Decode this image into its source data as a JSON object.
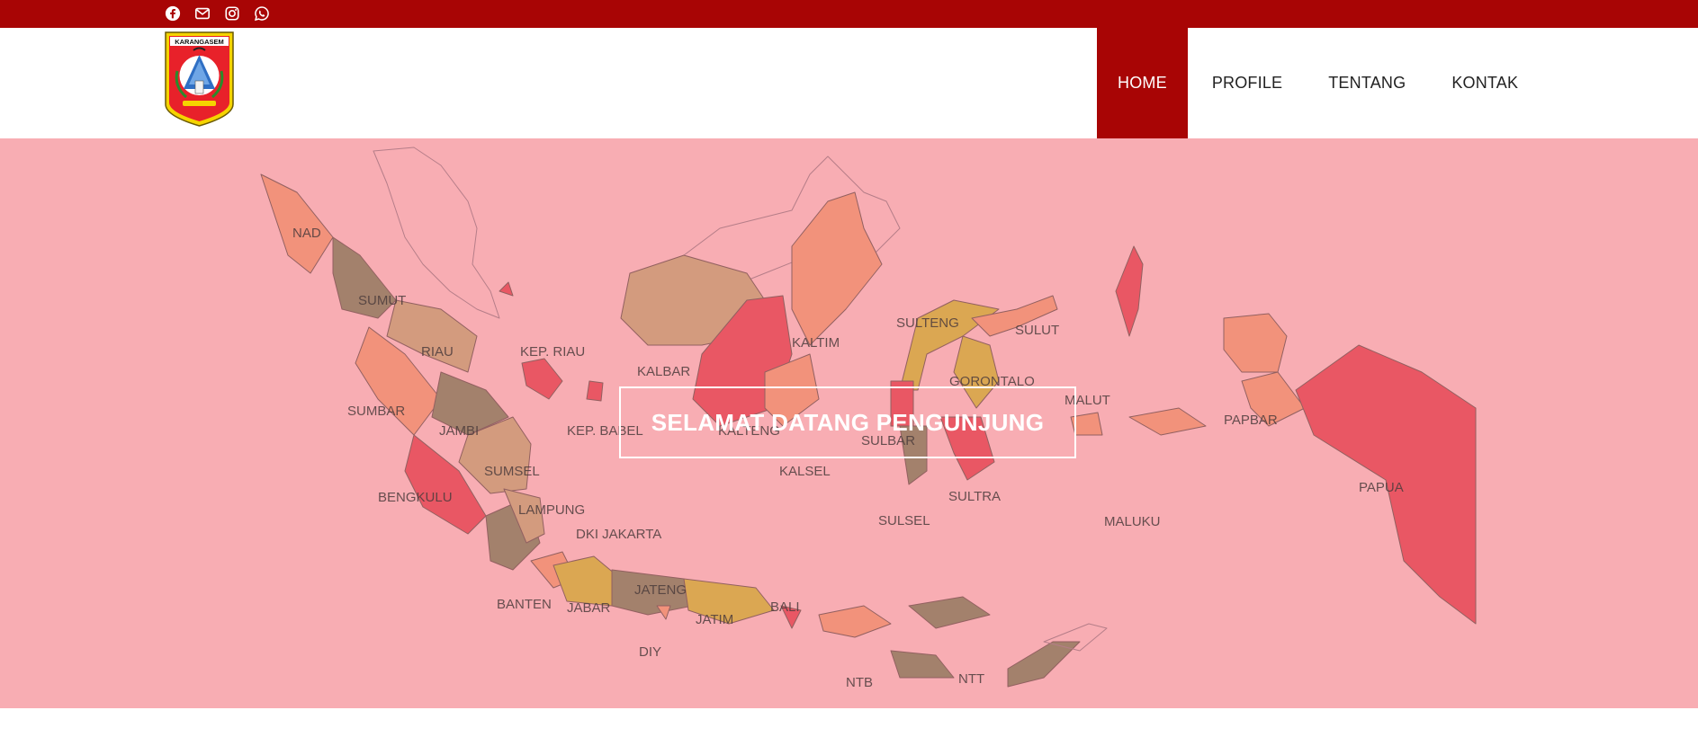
{
  "colors": {
    "brand_red": "#a80505",
    "hero_pink": "#f8adb3"
  },
  "topbar": {
    "social_icons": [
      "facebook-icon",
      "envelope-icon",
      "instagram-icon",
      "whatsapp-icon"
    ]
  },
  "header": {
    "logo_text": "KARANGASEM"
  },
  "nav": {
    "items": [
      {
        "label": "HOME",
        "active": true
      },
      {
        "label": "PROFILE",
        "active": false
      },
      {
        "label": "TENTANG",
        "active": false
      },
      {
        "label": "KONTAK",
        "active": false
      }
    ]
  },
  "hero": {
    "welcome_text": "SELAMAT DATANG PENGUNJUNG",
    "map_labels": [
      "NAD",
      "SUMUT",
      "RIAU",
      "KEP. RIAU",
      "SUMBAR",
      "JAMBI",
      "KEP. BABEL",
      "SUMSEL",
      "BENGKULU",
      "LAMPUNG",
      "DKI JAKARTA",
      "BANTEN",
      "JABAR",
      "JATENG",
      "DIY",
      "JATIM",
      "BALI",
      "KALBAR",
      "KALTIM",
      "KALTENG",
      "KALSEL",
      "SULTENG",
      "SULUT",
      "GORONTALO",
      "SULBAR",
      "SULSEL",
      "SULTRA",
      "MALUT",
      "MALUKU",
      "PAPBAR",
      "PAPUA",
      "NTB",
      "NTT"
    ]
  }
}
